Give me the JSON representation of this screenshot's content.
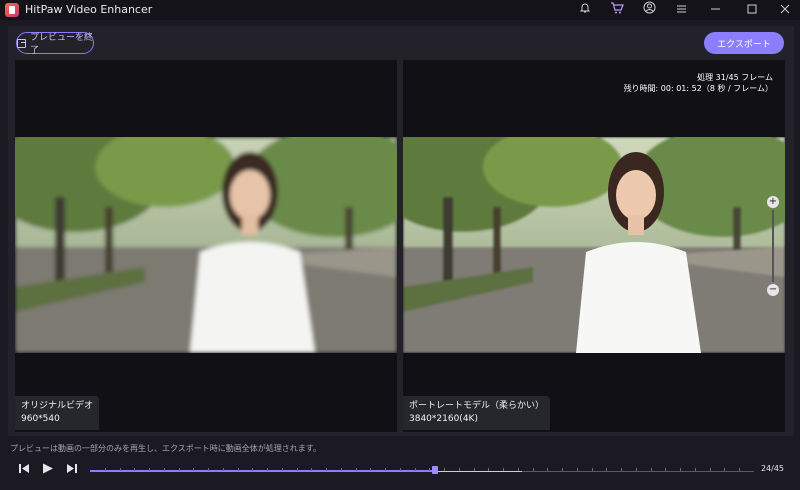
{
  "app": {
    "title": "HitPaw Video Enhancer"
  },
  "titlebar_icons": [
    "bell-icon",
    "cart-icon",
    "account-icon",
    "menu-icon",
    "minimize-icon",
    "maximize-icon",
    "close-icon"
  ],
  "toolbar": {
    "exit_preview_label": "プレビューを終了",
    "export_label": "エクスポート"
  },
  "original": {
    "label": "オリジナルビデオ",
    "resolution": "960*540"
  },
  "enhanced": {
    "label": "ポートレートモデル（柔らかい）",
    "resolution": "3840*2160(4K)",
    "processing_text": "処理 31/45 フレーム",
    "remaining_text": "残り時間: 00: 01: 52（8 秒 / フレーム）"
  },
  "footer": {
    "note": "プレビューは動画の一部分のみを再生し、エクスポート時に動画全体が処理されます。",
    "frame_counter": "24/45",
    "current_frame": 24,
    "total_frames": 45,
    "processed_frames": 31
  },
  "colors": {
    "accent": "#8c7dff",
    "background": "#1b1a22"
  }
}
